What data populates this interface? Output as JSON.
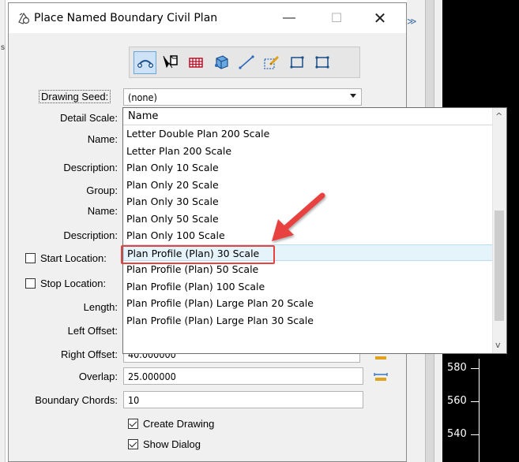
{
  "window": {
    "title": "Place Named Boundary Civil Plan"
  },
  "toolbar": {
    "tools": [
      "civil-plan-tool",
      "civil-profile-tool",
      "cross-section-tool",
      "3d-cut-tool",
      "two-point-tool",
      "from-element-tool",
      "view-tool",
      "shape-tool"
    ]
  },
  "form": {
    "drawing_seed_label": "Drawing Seed:",
    "drawing_seed_value": "(none)",
    "detail_scale_label": "Detail Scale:",
    "name_label": "Name:",
    "description_label": "Description:",
    "group_label": "Group:",
    "name2_label": "Name:",
    "description2_label": "Description:",
    "start_location_label": "Start Location:",
    "stop_location_label": "Stop Location:",
    "length_label": "Length:",
    "left_offset_label": "Left Offset:",
    "right_offset_label": "Right Offset:",
    "right_offset_value": "40.000000",
    "overlap_label": "Overlap:",
    "overlap_value": "25.000000",
    "boundary_chords_label": "Boundary Chords:",
    "boundary_chords_value": "10",
    "create_drawing_label": "Create Drawing",
    "show_dialog_label": "Show Dialog"
  },
  "dropdown": {
    "header": "Name",
    "items": [
      "Letter Double Plan 200 Scale",
      "Letter Plan 200 Scale",
      "Plan Only 10 Scale",
      "Plan Only 20 Scale",
      "Plan Only 30 Scale",
      "Plan Only 50 Scale",
      "Plan Only 100 Scale",
      "Plan Profile (Plan) 30 Scale",
      "Plan Profile (Plan) 50 Scale",
      "Plan Profile (Plan) 100 Scale",
      "Plan Profile (Plan) Large Plan 20 Scale",
      "Plan Profile (Plan) Large Plan 30 Scale"
    ],
    "highlighted_index": 7
  },
  "background": {
    "axis_labels": [
      "580",
      "560",
      "540"
    ]
  },
  "colors": {
    "highlight_border": "#e8433f",
    "hover_row": "#e5f3fb",
    "toolbar_active": "#cde2f7"
  }
}
